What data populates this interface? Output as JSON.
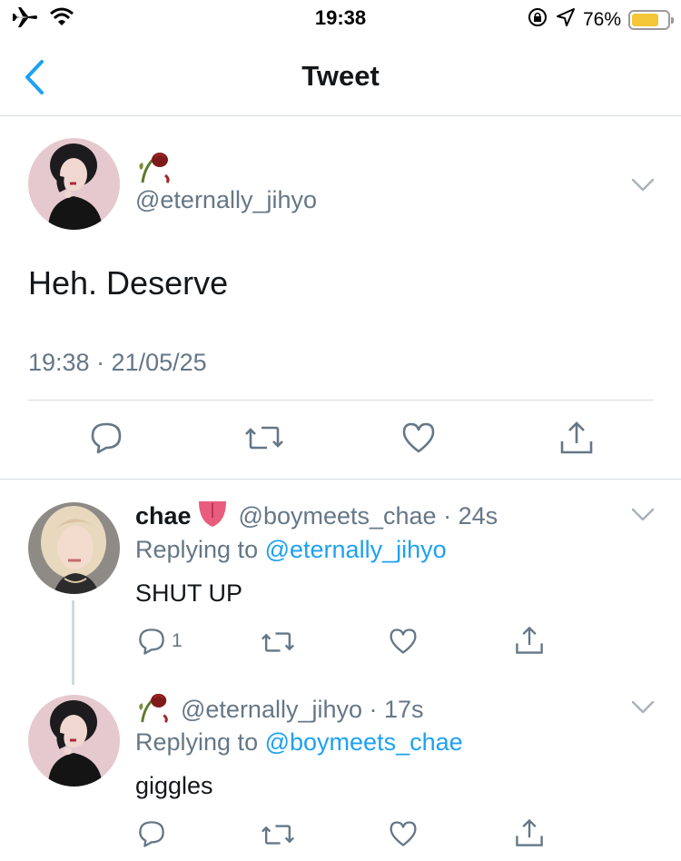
{
  "status_bar": {
    "time": "19:38",
    "battery_percent_text": "76%",
    "battery_level": 0.76,
    "battery_color": "#f2c636",
    "icons": [
      "airplane-icon",
      "wifi-icon",
      "orientation-lock-icon",
      "location-arrow-icon",
      "battery-icon"
    ]
  },
  "navbar": {
    "title": "Tweet",
    "back_icon": "chevron-left-icon",
    "accent": "#1da1f2"
  },
  "main_tweet": {
    "handle": "@eternally_jihyo",
    "name_emoji": "wilted-rose-emoji",
    "text": "Heh. Deserve",
    "meta": "19:38 · 21/05/25",
    "actions": [
      "reply-icon",
      "retweet-icon",
      "like-icon",
      "share-icon"
    ]
  },
  "replies": [
    {
      "display_name": "chae",
      "name_emoji": "tongue-emoji",
      "handle": "@boymeets_chae",
      "time": "24s",
      "replying_prefix": "Replying to",
      "replying_to": "@eternally_jihyo",
      "text": "SHUT UP",
      "reply_count": "1"
    },
    {
      "display_name": "",
      "name_emoji": "wilted-rose-emoji",
      "handle": "@eternally_jihyo",
      "time": "17s",
      "replying_prefix": "Replying to",
      "replying_to": "@boymeets_chae",
      "text": "giggles",
      "reply_count": ""
    }
  ],
  "colors": {
    "text_primary": "#14171a",
    "text_secondary": "#657786",
    "link": "#1da1f2",
    "divider": "#d7dbde"
  }
}
